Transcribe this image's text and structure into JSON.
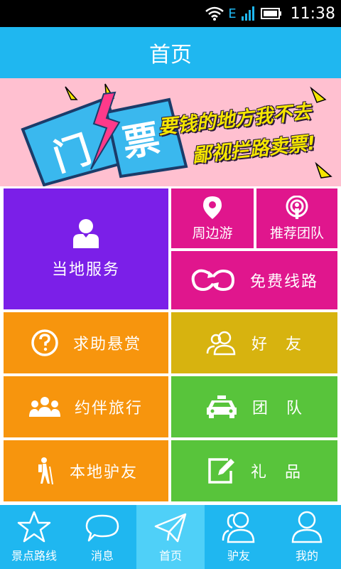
{
  "status_bar": {
    "time": "11:38",
    "network": "E"
  },
  "header": {
    "title": "首页"
  },
  "banner": {
    "badge_left": "门",
    "badge_right": "票",
    "line1": "要钱的地方我不去",
    "line2": "鄙视拦路卖票!"
  },
  "tiles": {
    "local_service": "当地服务",
    "nearby": "周边游",
    "recommended_team": "推荐团队",
    "free_routes": "免费线路",
    "help_reward": "求助悬赏",
    "friends": "好　友",
    "companion_travel": "约伴旅行",
    "team": "团　队",
    "local_friends": "本地驴友",
    "gifts": "礼　品"
  },
  "tabs": [
    {
      "label": "景点路线",
      "icon": "star-icon"
    },
    {
      "label": "消息",
      "icon": "chat-bubble-icon"
    },
    {
      "label": "首页",
      "icon": "paper-plane-icon",
      "active": true
    },
    {
      "label": "驴友",
      "icon": "users-icon"
    },
    {
      "label": "我的",
      "icon": "user-icon"
    }
  ],
  "colors": {
    "primary": "#1fb7f0",
    "purple": "#7b1fe8",
    "magenta": "#e0168d",
    "orange": "#f7950d",
    "mustard": "#d7b30f",
    "green": "#58c43b",
    "banner_bg": "#ffc0d0"
  }
}
